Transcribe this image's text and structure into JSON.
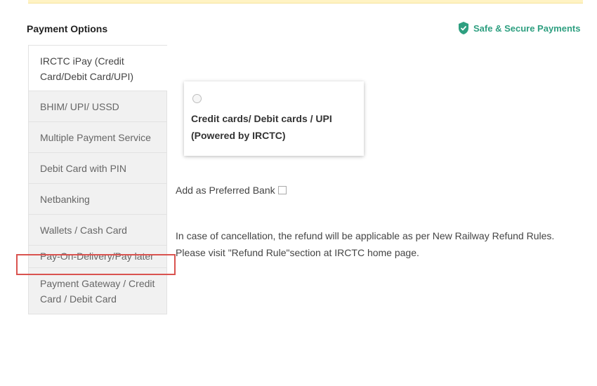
{
  "payment_options": {
    "heading": "Payment Options",
    "secure_label": "Safe & Secure Payments",
    "items": [
      {
        "label": "IRCTC iPay (Credit Card/Debit Card/UPI)"
      },
      {
        "label": "BHIM/ UPI/ USSD"
      },
      {
        "label": "Multiple Payment Service"
      },
      {
        "label": "Debit Card with PIN"
      },
      {
        "label": "Netbanking"
      },
      {
        "label": "Wallets / Cash Card"
      },
      {
        "label": "Pay-On-Delivery/Pay later"
      },
      {
        "label": "Payment Gateway / Credit Card / Debit Card"
      }
    ]
  },
  "option_card": {
    "label": "Credit cards/ Debit cards / UPI (Powered by IRCTC)"
  },
  "preferred_bank": {
    "label": "Add as Preferred Bank"
  },
  "refund_note": "In case of cancellation, the refund will be applicable as per New Railway Refund Rules. Please visit \"Refund Rule\"section at IRCTC home page.",
  "colors": {
    "secure_green": "#2e9f80",
    "highlight_red": "#d9534f",
    "sidebar_bg": "#f1f1f1"
  }
}
